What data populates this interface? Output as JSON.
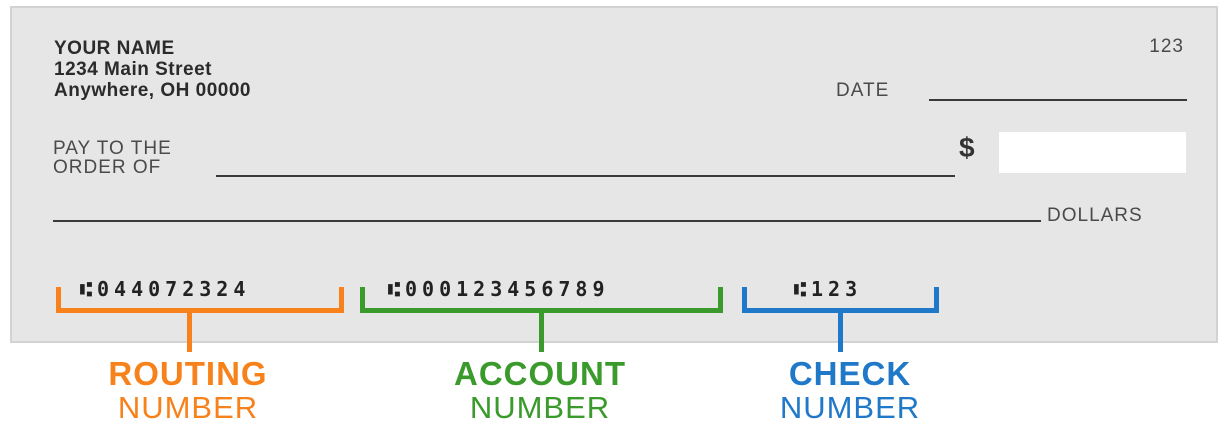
{
  "owner": {
    "name": "YOUR NAME",
    "street": "1234 Main Street",
    "city": "Anywhere, OH 00000"
  },
  "check_number": "123",
  "date_label": "DATE",
  "pay_to": {
    "line1": "PAY TO THE",
    "line2": "ORDER OF"
  },
  "currency_symbol": "$",
  "dollars_label": "DOLLARS",
  "micr": {
    "routing": "⑆044072324",
    "account": "⑆000123456789",
    "check": "⑆123"
  },
  "labels": {
    "routing": {
      "line1": "ROUTING",
      "line2": "NUMBER"
    },
    "account": {
      "line1": "ACCOUNT",
      "line2": "NUMBER"
    },
    "check": {
      "line1": "CHECK",
      "line2": "NUMBER"
    }
  },
  "colors": {
    "routing": "#f7821b",
    "account": "#3a9a2b",
    "check": "#1f78c8",
    "check_background": "#e6e6e6"
  }
}
